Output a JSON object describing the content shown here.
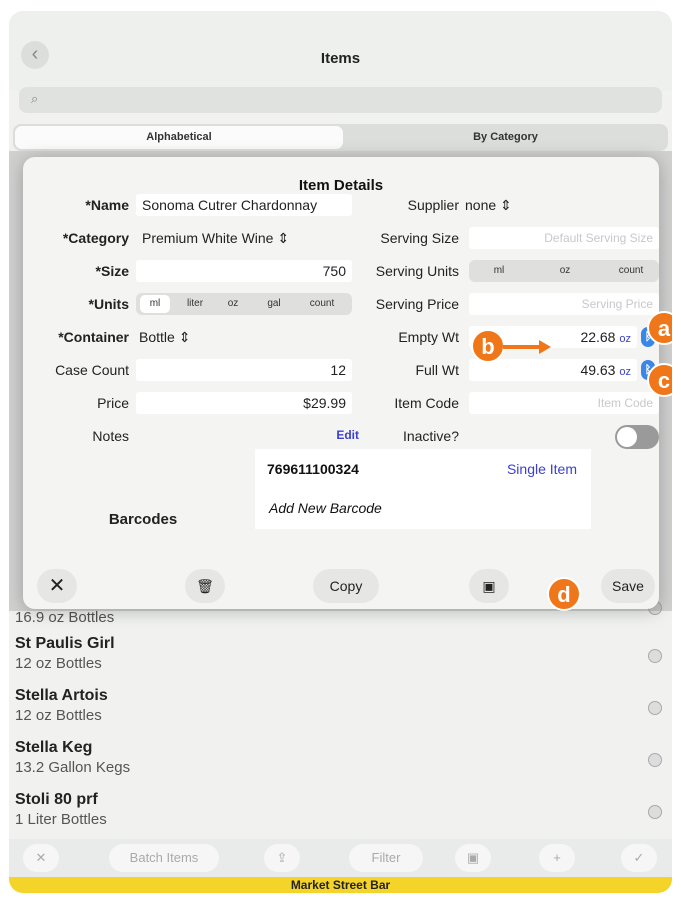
{
  "nav": {
    "title": "Items",
    "back_icon": "chevron-left-icon"
  },
  "search": {
    "icon": "search-icon"
  },
  "segments": {
    "left": "Alphabetical",
    "right": "By Category"
  },
  "list": [
    {
      "name": "",
      "sub": "16.9 oz Bottles"
    },
    {
      "name": "St Paulis Girl",
      "sub": "12 oz Bottles"
    },
    {
      "name": "Stella Artois",
      "sub": "12 oz Bottles"
    },
    {
      "name": "Stella Keg",
      "sub": "13.2 Gallon Kegs"
    },
    {
      "name": "Stoli 80 prf",
      "sub": "1 Liter Bottles"
    }
  ],
  "modal": {
    "title": "Item Details",
    "name_label": "*Name",
    "name_value": "Sonoma Cutrer Chardonnay",
    "category_label": "*Category",
    "category_value": "Premium White Wine",
    "size_label": "*Size",
    "size_value": "750",
    "units_label": "*Units",
    "units_options": [
      "ml",
      "liter",
      "oz",
      "gal",
      "count"
    ],
    "units_selected": "ml",
    "container_label": "*Container",
    "container_value": "Bottle",
    "case_label": "Case Count",
    "case_value": "12",
    "price_label": "Price",
    "price_value": "$29.99",
    "notes_label": "Notes",
    "notes_edit": "Edit",
    "supplier_label": "Supplier",
    "supplier_value": "none",
    "serving_size_label": "Serving Size",
    "serving_size_placeholder": "Default Serving Size",
    "serving_units_label": "Serving Units",
    "serving_units_options": [
      "ml",
      "oz",
      "count"
    ],
    "serving_price_label": "Serving Price",
    "serving_price_placeholder": "Serving Price",
    "empty_label": "Empty Wt",
    "empty_value": "22.68",
    "empty_unit": "oz",
    "full_label": "Full Wt",
    "full_value": "49.63",
    "full_unit": "oz",
    "item_code_label": "Item Code",
    "item_code_placeholder": "Item Code",
    "inactive_label": "Inactive?",
    "barcodes_label": "Barcodes",
    "barcode_value": "769611100324",
    "barcode_type": "Single Item",
    "add_barcode": "Add New Barcode",
    "copy_label": "Copy",
    "save_label": "Save"
  },
  "annotations": {
    "a": "a",
    "b": "b",
    "c": "c",
    "d": "d"
  },
  "bottom_bar": {
    "batch": "Batch Items",
    "filter": "Filter"
  },
  "footer": "Market Street Bar",
  "colors": {
    "accent": "#3a3fd0",
    "badge": "#f0761a",
    "footer": "#f5d42a",
    "bluetooth": "#3a87e8"
  }
}
